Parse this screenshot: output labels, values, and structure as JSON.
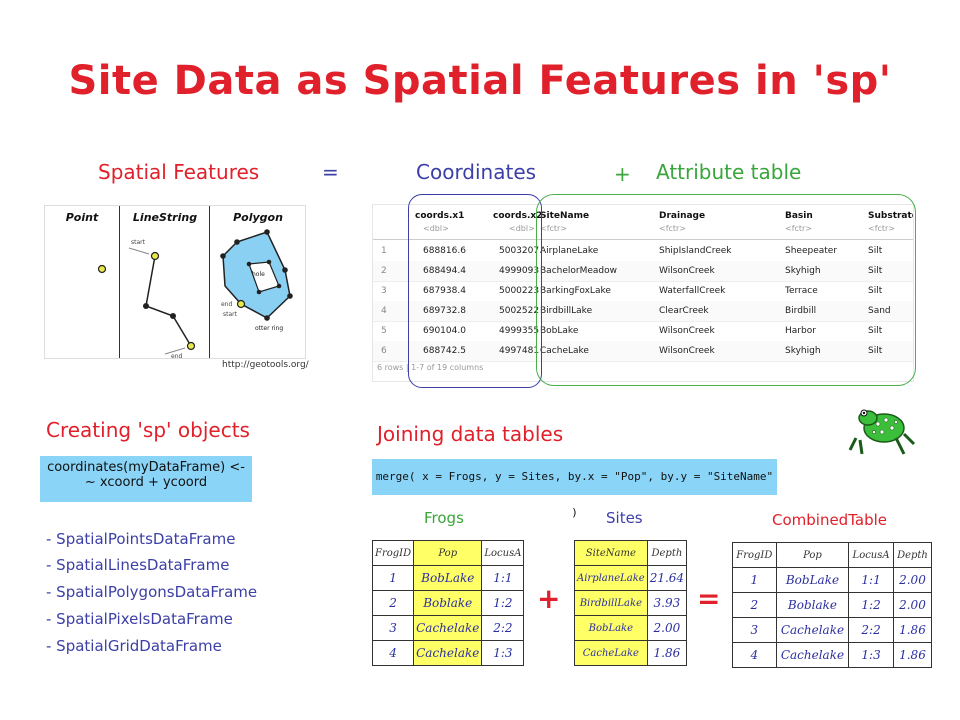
{
  "title": "Site Data as Spatial Features in 'sp'",
  "headers": {
    "spatial_features": "Spatial Features",
    "equals": "=",
    "coordinates": "Coordinates",
    "plus": "+",
    "attribute_table": "Attribute table"
  },
  "features_figure": {
    "point": "Point",
    "linestring": "LineString",
    "polygon": "Polygon",
    "start": "start",
    "end": "end",
    "hole": "hole",
    "outer_ring": "otter ring",
    "credit": "http://geotools.org/"
  },
  "rtable": {
    "columns": [
      {
        "name": "coords.x1",
        "type": "<dbl>"
      },
      {
        "name": "coords.x2",
        "type": "<dbl>"
      },
      {
        "name": "SiteName",
        "type": "<fctr>"
      },
      {
        "name": "Drainage",
        "type": "<fctr>"
      },
      {
        "name": "Basin",
        "type": "<fctr>"
      },
      {
        "name": "Substrate",
        "type": "<fctr>"
      }
    ],
    "rows": [
      [
        "1",
        "688816.6",
        "5003207",
        "AirplaneLake",
        "ShipIslandCreek",
        "Sheepeater",
        "Silt"
      ],
      [
        "2",
        "688494.4",
        "4999093",
        "BachelorMeadow",
        "WilsonCreek",
        "Skyhigh",
        "Silt"
      ],
      [
        "3",
        "687938.4",
        "5000223",
        "BarkingFoxLake",
        "WaterfallCreek",
        "Terrace",
        "Silt"
      ],
      [
        "4",
        "689732.8",
        "5002522",
        "BirdbillLake",
        "ClearCreek",
        "Birdbill",
        "Sand"
      ],
      [
        "5",
        "690104.0",
        "4999355",
        "BobLake",
        "WilsonCreek",
        "Harbor",
        "Silt"
      ],
      [
        "6",
        "688742.5",
        "4997481",
        "CacheLake",
        "WilsonCreek",
        "Skyhigh",
        "Silt"
      ]
    ],
    "footer": "6 rows | 1-7 of 19 columns"
  },
  "creating": {
    "heading": "Creating 'sp' objects",
    "code_line1": "coordinates(myDataFrame) <-",
    "code_line2": "~ xcoord + ycoord",
    "classes": [
      "- SpatialPointsDataFrame",
      "- SpatialLinesDataFrame",
      "- SpatialPolygonsDataFrame",
      "- SpatialPixelsDataFrame",
      "- SpatialGridDataFrame"
    ]
  },
  "joining": {
    "heading": "Joining data tables",
    "code": "merge( x = Frogs, y = Sites, by.x = \"Pop\", by.y = \"SiteName\" )",
    "plus": "+",
    "equals": "=",
    "frogs": {
      "title": "Frogs",
      "header": [
        "FrogID",
        "Pop",
        "LocusA"
      ],
      "rows": [
        [
          "1",
          "BobLake",
          "1:1"
        ],
        [
          "2",
          "Boblake",
          "1:2"
        ],
        [
          "3",
          "Cachelake",
          "2:2"
        ],
        [
          "4",
          "Cachelake",
          "1:3"
        ]
      ]
    },
    "sites": {
      "title": "Sites",
      "header": [
        "SiteName",
        "Depth"
      ],
      "rows": [
        [
          "AirplaneLake",
          "21.64"
        ],
        [
          "BirdbillLake",
          "3.93"
        ],
        [
          "BobLake",
          "2.00"
        ],
        [
          "CacheLake",
          "1.86"
        ]
      ]
    },
    "combined": {
      "title": "CombinedTable",
      "header": [
        "FrogID",
        "Pop",
        "LocusA",
        "Depth"
      ],
      "rows": [
        [
          "1",
          "BobLake",
          "1:1",
          "2.00"
        ],
        [
          "2",
          "Boblake",
          "1:2",
          "2.00"
        ],
        [
          "3",
          "Cachelake",
          "2:2",
          "1.86"
        ],
        [
          "4",
          "Cachelake",
          "1:3",
          "1.86"
        ]
      ]
    }
  },
  "colors": {
    "red": "#e0202a",
    "blue": "#3b3fa6",
    "green": "#3aa53a",
    "code_bg": "#8ad4f7",
    "highlight": "#ffff66"
  }
}
